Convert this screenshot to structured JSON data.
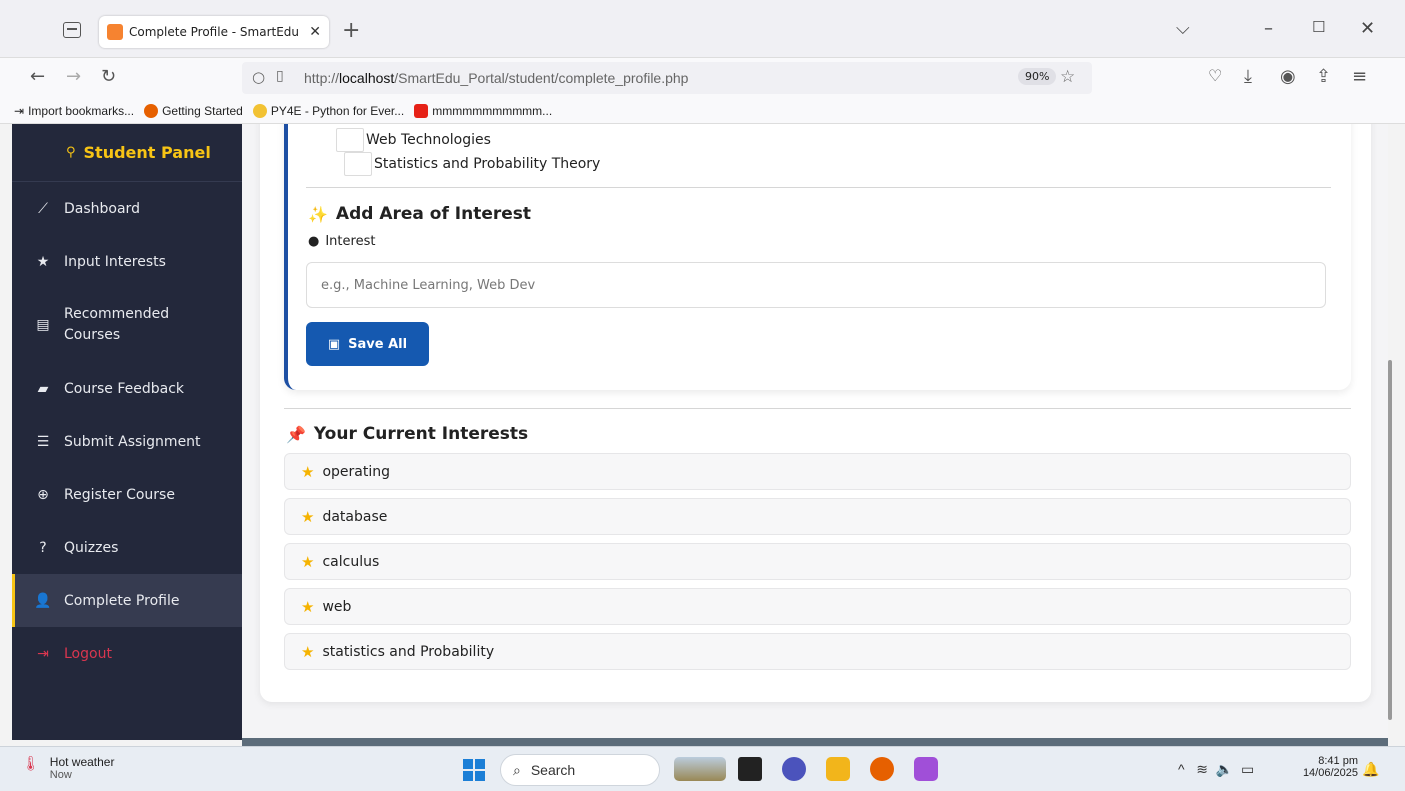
{
  "browser": {
    "tab_title": "Complete Profile - SmartEdu Po",
    "url_prefix": "http://",
    "url_host": "localhost",
    "url_path": "/SmartEdu_Portal/student/complete_profile.php",
    "zoom": "90%",
    "bookmarks": [
      "Import bookmarks...",
      "Getting Started",
      "PY4E - Python for Ever...",
      "mmmmmmmmmmm..."
    ]
  },
  "sidebar": {
    "brand": "Student Panel",
    "items": [
      {
        "label": "Dashboard",
        "icon": "chart-line-icon"
      },
      {
        "label": "Input Interests",
        "icon": "star-icon"
      },
      {
        "label": "Recommended Courses",
        "icon": "book-icon"
      },
      {
        "label": "Course Feedback",
        "icon": "comment-icon"
      },
      {
        "label": "Submit Assignment",
        "icon": "tasks-icon"
      },
      {
        "label": "Register Course",
        "icon": "plus-circle-icon"
      },
      {
        "label": "Quizzes",
        "icon": "question-circle-icon"
      },
      {
        "label": "Complete Profile",
        "icon": "user-edit-icon"
      },
      {
        "label": "Logout",
        "icon": "sign-out-icon"
      }
    ]
  },
  "form": {
    "courses": [
      "Web Technologies",
      "Statistics and Probability Theory"
    ],
    "add_heading": "Add Area of Interest",
    "interest_label": "Interest",
    "interest_placeholder": "e.g., Machine Learning, Web Dev",
    "save_label": "Save All"
  },
  "current": {
    "heading": "Your Current Interests",
    "items": [
      "operating",
      "database",
      "calculus",
      "web",
      "statistics and Probability"
    ]
  },
  "taskbar": {
    "weather_title": "Hot weather",
    "weather_sub": "Now",
    "search": "Search",
    "time": "8:41 pm",
    "date": "14/06/2025"
  },
  "colors": {
    "sidebar_bg": "#23283b",
    "brand": "#f7c415",
    "primary": "#1559b0",
    "logout": "#d9364f",
    "star": "#f5b301"
  }
}
